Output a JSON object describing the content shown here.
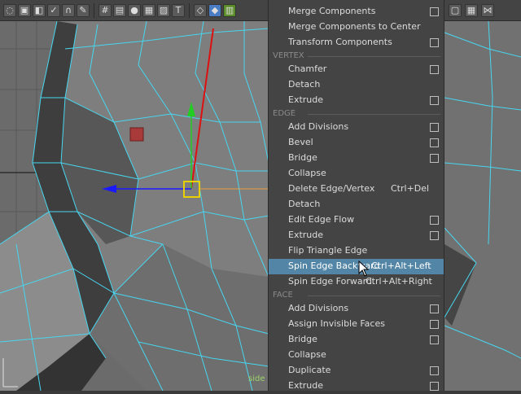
{
  "toolbar": {
    "left_icons": [
      "lasso-icon",
      "paint-select-icon",
      "sculpt-icon",
      "vertex-snap-icon",
      "magnet-icon",
      "brush-icon",
      "grid-icon",
      "film-icon",
      "sphere-icon",
      "checker-icon",
      "image-icon",
      "text-icon",
      "cube-icon",
      "cube-shaded-icon",
      "xray-icon"
    ],
    "text_icon_glyph": "T",
    "right_icons": [
      "panel-icon",
      "layout-icon",
      "network-icon"
    ]
  },
  "menu": {
    "sections": [
      {
        "header": "",
        "items": [
          {
            "label": "Merge Components",
            "shortcut": "",
            "option_box": true,
            "highlighted": false
          },
          {
            "label": "Merge Components to Center",
            "shortcut": "",
            "option_box": false,
            "highlighted": false
          },
          {
            "label": "Transform Components",
            "shortcut": "",
            "option_box": true,
            "highlighted": false
          }
        ]
      },
      {
        "header": "VERTEX",
        "items": [
          {
            "label": "Chamfer",
            "shortcut": "",
            "option_box": true,
            "highlighted": false
          },
          {
            "label": "Detach",
            "shortcut": "",
            "option_box": false,
            "highlighted": false
          },
          {
            "label": "Extrude",
            "shortcut": "",
            "option_box": true,
            "highlighted": false
          }
        ]
      },
      {
        "header": "EDGE",
        "items": [
          {
            "label": "Add Divisions",
            "shortcut": "",
            "option_box": true,
            "highlighted": false
          },
          {
            "label": "Bevel",
            "shortcut": "",
            "option_box": true,
            "highlighted": false
          },
          {
            "label": "Bridge",
            "shortcut": "",
            "option_box": true,
            "highlighted": false
          },
          {
            "label": "Collapse",
            "shortcut": "",
            "option_box": false,
            "highlighted": false
          },
          {
            "label": "Delete Edge/Vertex",
            "shortcut": "Ctrl+Del",
            "option_box": false,
            "highlighted": false
          },
          {
            "label": "Detach",
            "shortcut": "",
            "option_box": false,
            "highlighted": false
          },
          {
            "label": "Edit Edge Flow",
            "shortcut": "",
            "option_box": true,
            "highlighted": false
          },
          {
            "label": "Extrude",
            "shortcut": "",
            "option_box": true,
            "highlighted": false
          },
          {
            "label": "Flip Triangle Edge",
            "shortcut": "",
            "option_box": false,
            "highlighted": false
          },
          {
            "label": "Spin Edge Backward",
            "shortcut": "Ctrl+Alt+Left",
            "option_box": false,
            "highlighted": true
          },
          {
            "label": "Spin Edge Forward",
            "shortcut": "Ctrl+Alt+Right",
            "option_box": false,
            "highlighted": false
          }
        ]
      },
      {
        "header": "FACE",
        "items": [
          {
            "label": "Add Divisions",
            "shortcut": "",
            "option_box": true,
            "highlighted": false
          },
          {
            "label": "Assign Invisible Faces",
            "shortcut": "",
            "option_box": true,
            "highlighted": false
          },
          {
            "label": "Bridge",
            "shortcut": "",
            "option_box": true,
            "highlighted": false
          },
          {
            "label": "Collapse",
            "shortcut": "",
            "option_box": false,
            "highlighted": false
          },
          {
            "label": "Duplicate",
            "shortcut": "",
            "option_box": true,
            "highlighted": false
          },
          {
            "label": "Extrude",
            "shortcut": "",
            "option_box": true,
            "highlighted": false
          }
        ]
      }
    ]
  },
  "viewport": {
    "label": "side",
    "wire_color": "#47d6f0",
    "manipulator_colors": {
      "x": "#1a1aff",
      "y": "#22cc22",
      "z": "#dd1111",
      "center": "#e8d000"
    }
  },
  "colors": {
    "menu_bg": "#444444",
    "highlight": "#5285a6"
  }
}
